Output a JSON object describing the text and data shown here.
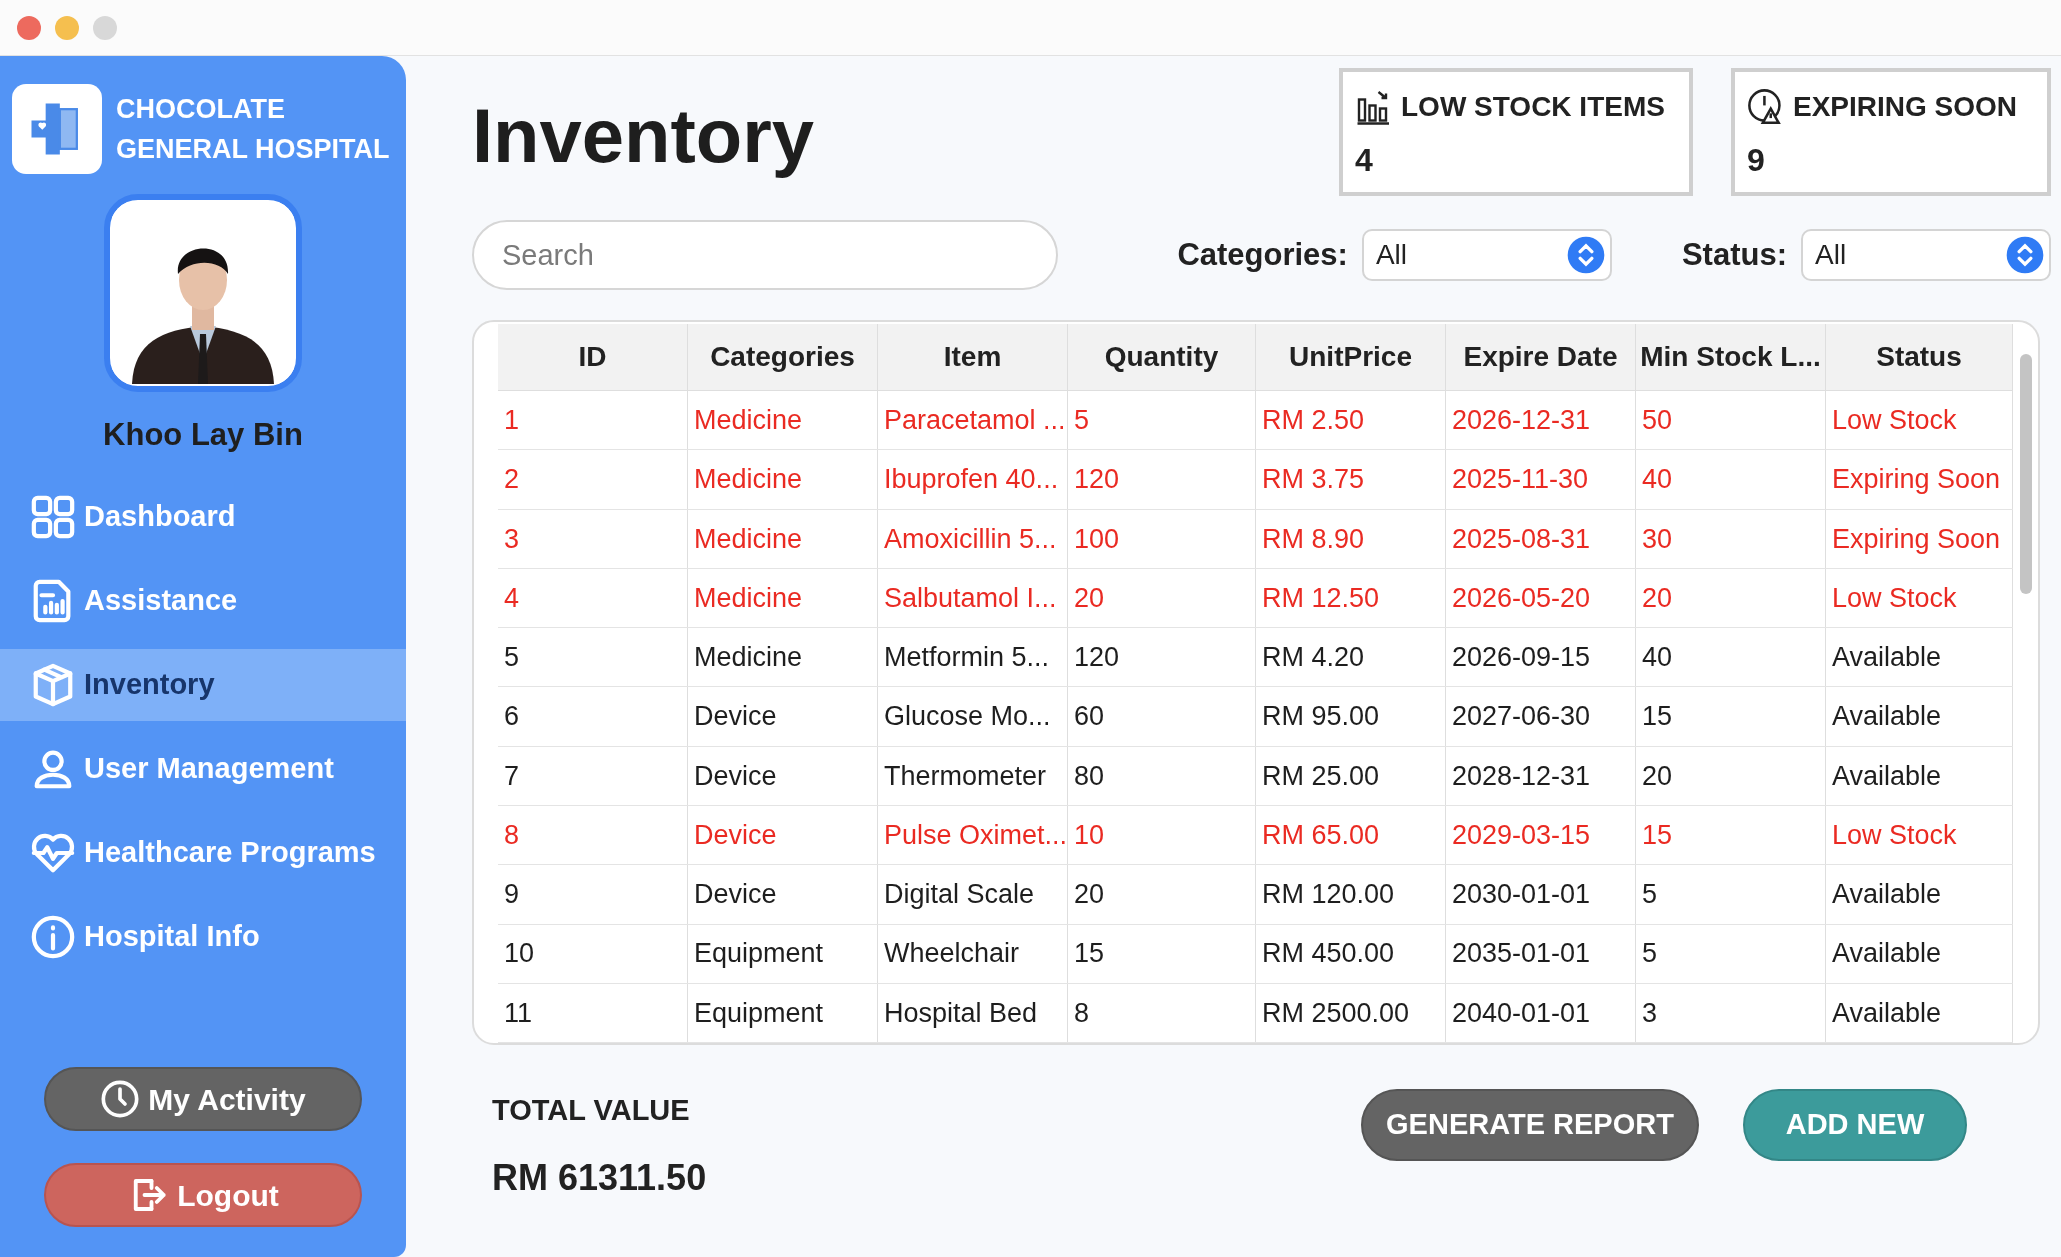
{
  "hospital": {
    "name_line1": "CHOCOLATE",
    "name_line2": "GENERAL HOSPITAL"
  },
  "user": {
    "name": "Khoo Lay Bin"
  },
  "sidebar": {
    "items": [
      {
        "label": "Dashboard",
        "kind": "grid",
        "selected": false
      },
      {
        "label": "Assistance",
        "kind": "report",
        "selected": false
      },
      {
        "label": "Inventory",
        "kind": "box",
        "selected": true
      },
      {
        "label": "User Management",
        "kind": "user",
        "selected": false
      },
      {
        "label": "Healthcare Programs",
        "kind": "heart",
        "selected": false
      },
      {
        "label": "Hospital Info",
        "kind": "info",
        "selected": false
      }
    ],
    "buttons": [
      {
        "label": "My Activity",
        "kind": "activity"
      },
      {
        "label": "Logout",
        "kind": "logout"
      }
    ]
  },
  "page": {
    "title": "Inventory"
  },
  "stats": [
    {
      "label": "LOW STOCK ITEMS",
      "value": "4",
      "kind": "chart"
    },
    {
      "label": "EXPIRING SOON",
      "value": "9",
      "kind": "clock"
    }
  ],
  "search": {
    "placeholder": "Search"
  },
  "filters": [
    {
      "label": "Categories:",
      "value": "All"
    },
    {
      "label": "Status:",
      "value": "All"
    }
  ],
  "table": {
    "columns": [
      "ID",
      "Categories",
      "Item",
      "Quantity",
      "UnitPrice",
      "Expire Date",
      "Min Stock L...",
      "Status"
    ],
    "rows": [
      {
        "cells": [
          "1",
          "Medicine",
          "Paracetamol ...",
          "5",
          "RM 2.50",
          "2026-12-31",
          "50",
          "Low Stock"
        ],
        "alert": true
      },
      {
        "cells": [
          "2",
          "Medicine",
          "Ibuprofen 40...",
          "120",
          "RM 3.75",
          "2025-11-30",
          "40",
          "Expiring Soon"
        ],
        "alert": true
      },
      {
        "cells": [
          "3",
          "Medicine",
          "Amoxicillin 5...",
          "100",
          "RM 8.90",
          "2025-08-31",
          "30",
          "Expiring Soon"
        ],
        "alert": true
      },
      {
        "cells": [
          "4",
          "Medicine",
          "Salbutamol I...",
          "20",
          "RM 12.50",
          "2026-05-20",
          "20",
          "Low Stock"
        ],
        "alert": true
      },
      {
        "cells": [
          "5",
          "Medicine",
          "Metformin 5...",
          "120",
          "RM 4.20",
          "2026-09-15",
          "40",
          "Available"
        ],
        "alert": false
      },
      {
        "cells": [
          "6",
          "Device",
          "Glucose Mo...",
          "60",
          "RM 95.00",
          "2027-06-30",
          "15",
          "Available"
        ],
        "alert": false
      },
      {
        "cells": [
          "7",
          "Device",
          "Thermometer",
          "80",
          "RM 25.00",
          "2028-12-31",
          "20",
          "Available"
        ],
        "alert": false
      },
      {
        "cells": [
          "8",
          "Device",
          "Pulse Oximet...",
          "10",
          "RM 65.00",
          "2029-03-15",
          "15",
          "Low Stock"
        ],
        "alert": true
      },
      {
        "cells": [
          "9",
          "Device",
          "Digital Scale",
          "20",
          "RM 120.00",
          "2030-01-01",
          "5",
          "Available"
        ],
        "alert": false
      },
      {
        "cells": [
          "10",
          "Equipment",
          "Wheelchair",
          "15",
          "RM 450.00",
          "2035-01-01",
          "5",
          "Available"
        ],
        "alert": false
      },
      {
        "cells": [
          "11",
          "Equipment",
          "Hospital Bed",
          "8",
          "RM 2500.00",
          "2040-01-01",
          "3",
          "Available"
        ],
        "alert": false
      }
    ]
  },
  "total": {
    "label": "TOTAL VALUE",
    "value": "RM 61311.50"
  },
  "actions": [
    {
      "label": "GENERATE REPORT",
      "kind": "secondary"
    },
    {
      "label": "ADD NEW",
      "kind": "primary"
    }
  ]
}
